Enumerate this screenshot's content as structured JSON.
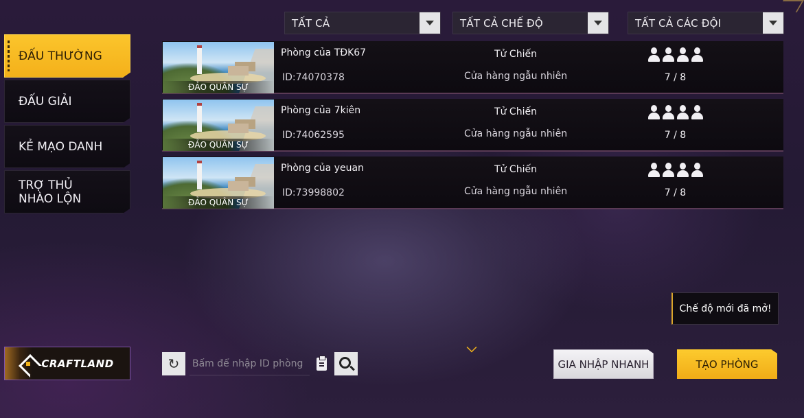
{
  "filters": [
    {
      "label": "TẤT CẢ"
    },
    {
      "label": "TẤT CẢ CHẾ ĐỘ"
    },
    {
      "label": "TẤT CẢ CÁC ĐỘI"
    }
  ],
  "sidebar": {
    "items": [
      {
        "label": "ĐẤU THƯỜNG",
        "active": true
      },
      {
        "label": "ĐẤU GIẢI",
        "active": false
      },
      {
        "label": "KẺ MẠO DANH",
        "active": false
      },
      {
        "label": "TRỢ THỦ NHÀO LỘN",
        "active": false
      }
    ]
  },
  "rooms": [
    {
      "map": "ĐẢO QUÂN SỰ",
      "name": "Phòng của TĐK67",
      "id": "ID:74070378",
      "mode": "Tử Chiến",
      "shop": "Cửa hàng ngẫu nhiên",
      "players": "7 / 8"
    },
    {
      "map": "ĐẢO QUÂN SỰ",
      "name": "Phòng của 7kiên",
      "id": "ID:74062595",
      "mode": "Tử Chiến",
      "shop": "Cửa hàng ngẫu nhiên",
      "players": "7 / 8"
    },
    {
      "map": "ĐẢO QUÂN SỰ",
      "name": "Phòng của yeuan",
      "id": "ID:73998802",
      "mode": "Tử Chiến",
      "shop": "Cửa hàng ngẫu nhiên",
      "players": "7 / 8"
    }
  ],
  "bottom": {
    "craftland_label": "CRAFTLAND",
    "search_placeholder": "Bấm để nhập ID phòng",
    "toast": "Chế độ mới đã mở!",
    "quick_join": "GIA NHẬP NHANH",
    "create_room": "TẠO PHÒNG"
  },
  "colors": {
    "accent": "#F4B41A",
    "background": "#271C36"
  }
}
